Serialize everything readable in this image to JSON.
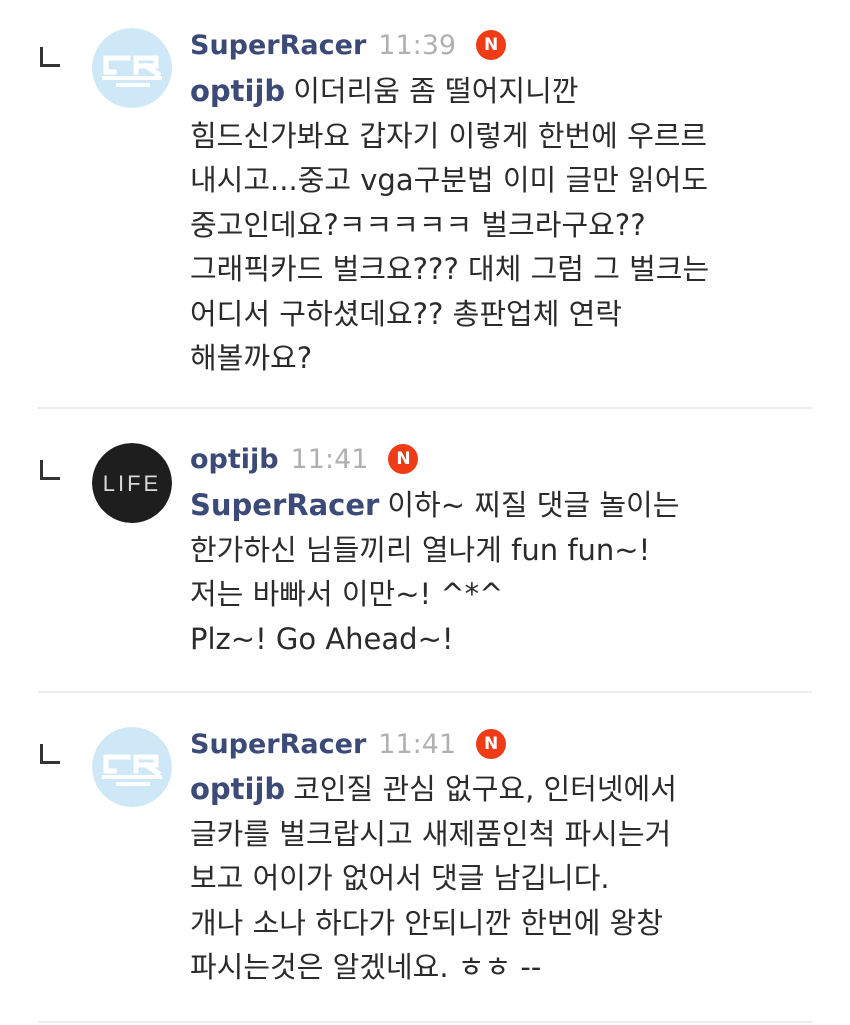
{
  "comments": [
    {
      "author": "SuperRacer",
      "time": "11:39",
      "badge": "N",
      "avatar_text": "CR",
      "mention": "optijb",
      "lines": [
        "이더리움 좀 떨어지니깐",
        "힘드신가봐요 갑자기 이렇게 한번에 우르르",
        "내시고...중고 vga구분법 이미 글만 읽어도",
        "중고인데요?ㅋㅋㅋㅋㅋ 벌크라구요??",
        "그래픽카드 벌크요??? 대체 그럼 그 벌크는",
        "어디서 구하셨데요?? 총판업체 연락",
        "해볼까요?"
      ]
    },
    {
      "author": "optijb",
      "time": "11:41",
      "badge": "N",
      "avatar_text": "LIFE",
      "mention": "SuperRacer",
      "lines": [
        "이하~ 찌질 댓글 놀이는",
        "한가하신 님들끼리 열나게 fun fun~!",
        "저는 바빠서 이만~! ^*^",
        "Plz~! Go Ahead~!"
      ]
    },
    {
      "author": "SuperRacer",
      "time": "11:41",
      "badge": "N",
      "avatar_text": "CR",
      "mention": "optijb",
      "lines": [
        "코인질 관심 없구요, 인터넷에서",
        "글카를 벌크랍시고 새제품인척 파시는거",
        "보고 어이가 없어서 댓글 남깁니다.",
        "개나 소나 하다가 안되니깐 한번에 왕창",
        "파시는것은 알겠네요. ㅎㅎ --"
      ]
    }
  ],
  "colors": {
    "author": "#3b4a77",
    "time": "#b0b0b0",
    "badge": "#f03c16",
    "avatar_cr_bg": "#cfe8f7",
    "avatar_life_bg": "#1e1e1e"
  }
}
